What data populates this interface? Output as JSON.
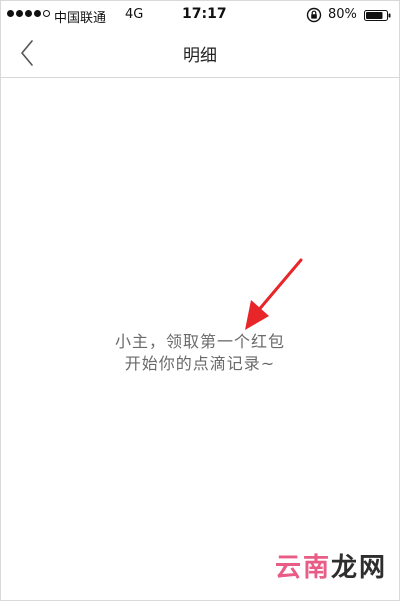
{
  "status_bar": {
    "carrier": "中国联通",
    "network": "4G",
    "time": "17:17",
    "battery": "80%"
  },
  "nav": {
    "title": "明细",
    "back_icon": "chevron-left-icon"
  },
  "empty_state": {
    "line1": "小主，领取第一个红包",
    "line2": "开始你的点滴记录~"
  },
  "watermark": {
    "char1": "云",
    "char2": "南",
    "char3": "龙",
    "char4": "网"
  },
  "colors": {
    "arrow": "#e8262a",
    "empty_text": "#6a6a6a",
    "watermark_pink": "#e85c86"
  }
}
